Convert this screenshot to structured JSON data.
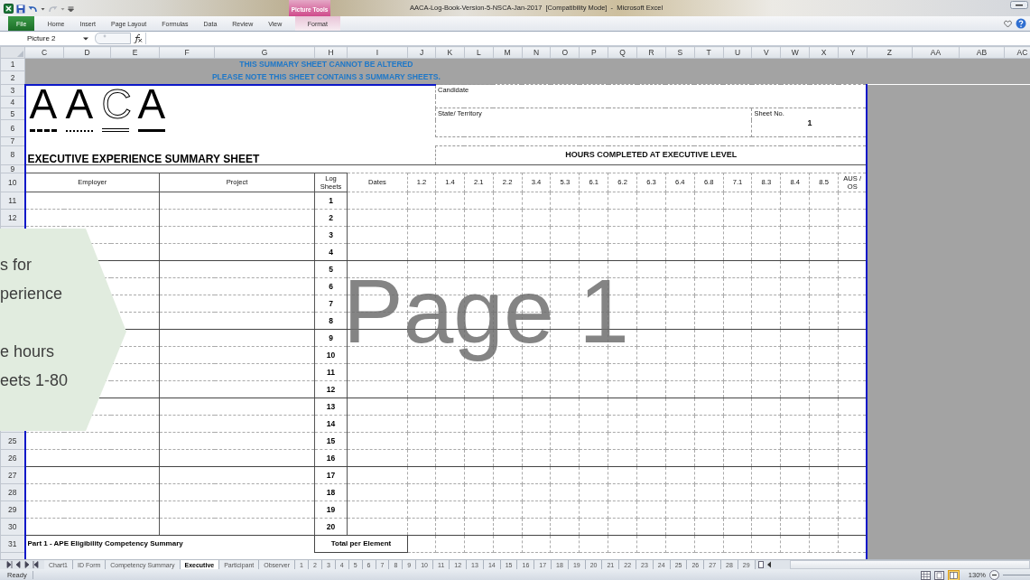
{
  "window": {
    "title": "AACA-Log-Book-Version-5-NSCA-Jan-2017  [Compatibility Mode]  -  Microsoft Excel"
  },
  "ribbon": {
    "contextual_group": "Picture Tools",
    "tabs": [
      {
        "label": "File",
        "kind": "file",
        "selected": false
      },
      {
        "label": "Home",
        "kind": "tab",
        "selected": false
      },
      {
        "label": "Insert",
        "kind": "tab",
        "selected": false
      },
      {
        "label": "Page Layout",
        "kind": "tab",
        "selected": false
      },
      {
        "label": "Formulas",
        "kind": "tab",
        "selected": false
      },
      {
        "label": "Data",
        "kind": "tab",
        "selected": false
      },
      {
        "label": "Review",
        "kind": "tab",
        "selected": false
      },
      {
        "label": "View",
        "kind": "tab",
        "selected": false
      },
      {
        "label": "Format",
        "kind": "contextual",
        "selected": false
      }
    ]
  },
  "formula_bar": {
    "name_box": "Picture 2"
  },
  "columns": [
    "C",
    "D",
    "E",
    "F",
    "G",
    "H",
    "I",
    "J",
    "K",
    "L",
    "M",
    "N",
    "O",
    "P",
    "Q",
    "R",
    "S",
    "T",
    "U",
    "V",
    "W",
    "X",
    "Y",
    "Z",
    "AA",
    "AB",
    "AC"
  ],
  "top_row_numbers": [
    "1",
    "2",
    "3",
    "4",
    "5",
    "6",
    "7",
    "8",
    "9",
    "10"
  ],
  "sheet": {
    "notice": [
      "THIS SUMMARY SHEET CANNOT BE ALTERED",
      "PLEASE NOTE THIS SHEET CONTAINS 3 SUMMARY SHEETS."
    ],
    "logo": "AACA",
    "title": "EXECUTIVE EXPERIENCE SUMMARY SHEET",
    "candidate_label": "Candidate",
    "state_label": "State/ Territory",
    "sheet_no_label": "Sheet No.",
    "sheet_no": "1",
    "hours_heading": "HOURS COMPLETED AT EXECUTIVE LEVEL",
    "headers": {
      "employer": "Employer",
      "project": "Project",
      "log_sheets": "Log Sheets",
      "dates": "Dates",
      "elements": [
        "1.2",
        "1.4",
        "2.1",
        "2.2",
        "3.4",
        "5.3",
        "6.1",
        "6.2",
        "6.3",
        "6.4",
        "6.8",
        "7.1",
        "8.3",
        "8.4",
        "8.5",
        "AUS / OS"
      ]
    },
    "rows": [
      {
        "row_number": "11",
        "log_sheet": "1"
      },
      {
        "row_number": "12",
        "log_sheet": "2"
      },
      {
        "log_sheet": "3"
      },
      {
        "log_sheet": "4"
      },
      {
        "log_sheet": "5"
      },
      {
        "log_sheet": "6"
      },
      {
        "log_sheet": "7"
      },
      {
        "log_sheet": "8"
      },
      {
        "log_sheet": "9"
      },
      {
        "log_sheet": "10"
      },
      {
        "log_sheet": "11"
      },
      {
        "log_sheet": "12"
      },
      {
        "log_sheet": "13"
      },
      {
        "log_sheet": "14"
      },
      {
        "row_number": "25",
        "log_sheet": "15"
      },
      {
        "row_number": "26",
        "log_sheet": "16"
      },
      {
        "row_number": "27",
        "log_sheet": "17"
      },
      {
        "row_number": "28",
        "log_sheet": "18"
      },
      {
        "row_number": "29",
        "log_sheet": "19"
      },
      {
        "row_number": "30",
        "log_sheet": "20"
      }
    ],
    "footer": {
      "row_number": "31",
      "part_label": "Part 1 - APE Eligibility Competency Summary",
      "total_label": "Total per Element"
    }
  },
  "page_label": "Page 1",
  "callout": {
    "paragraphs": [
      [
        "s for",
        "perience"
      ],
      [
        "e hours",
        "eets 1-80"
      ]
    ]
  },
  "sheet_tabs": [
    {
      "label": "Chart1",
      "selected": false
    },
    {
      "label": "ID Form",
      "selected": false
    },
    {
      "label": "Competency Summary",
      "selected": false
    },
    {
      "label": "Executive",
      "selected": true
    },
    {
      "label": "Participant",
      "selected": false
    },
    {
      "label": "Observer",
      "selected": false
    },
    {
      "label": "1",
      "selected": false
    },
    {
      "label": "2",
      "selected": false
    },
    {
      "label": "3",
      "selected": false
    },
    {
      "label": "4",
      "selected": false
    },
    {
      "label": "5",
      "selected": false
    },
    {
      "label": "6",
      "selected": false
    },
    {
      "label": "7",
      "selected": false
    },
    {
      "label": "8",
      "selected": false
    },
    {
      "label": "9",
      "selected": false
    },
    {
      "label": "10",
      "selected": false
    },
    {
      "label": "11",
      "selected": false
    },
    {
      "label": "12",
      "selected": false
    },
    {
      "label": "13",
      "selected": false
    },
    {
      "label": "14",
      "selected": false
    },
    {
      "label": "15",
      "selected": false
    },
    {
      "label": "16",
      "selected": false
    },
    {
      "label": "17",
      "selected": false
    },
    {
      "label": "18",
      "selected": false
    },
    {
      "label": "19",
      "selected": false
    },
    {
      "label": "20",
      "selected": false
    },
    {
      "label": "21",
      "selected": false
    },
    {
      "label": "22",
      "selected": false
    },
    {
      "label": "23",
      "selected": false
    },
    {
      "label": "24",
      "selected": false
    },
    {
      "label": "25",
      "selected": false
    },
    {
      "label": "26",
      "selected": false
    },
    {
      "label": "27",
      "selected": false
    },
    {
      "label": "28",
      "selected": false
    },
    {
      "label": "29",
      "selected": false
    }
  ],
  "status_bar": {
    "text": "Ready",
    "zoom": "130%"
  }
}
